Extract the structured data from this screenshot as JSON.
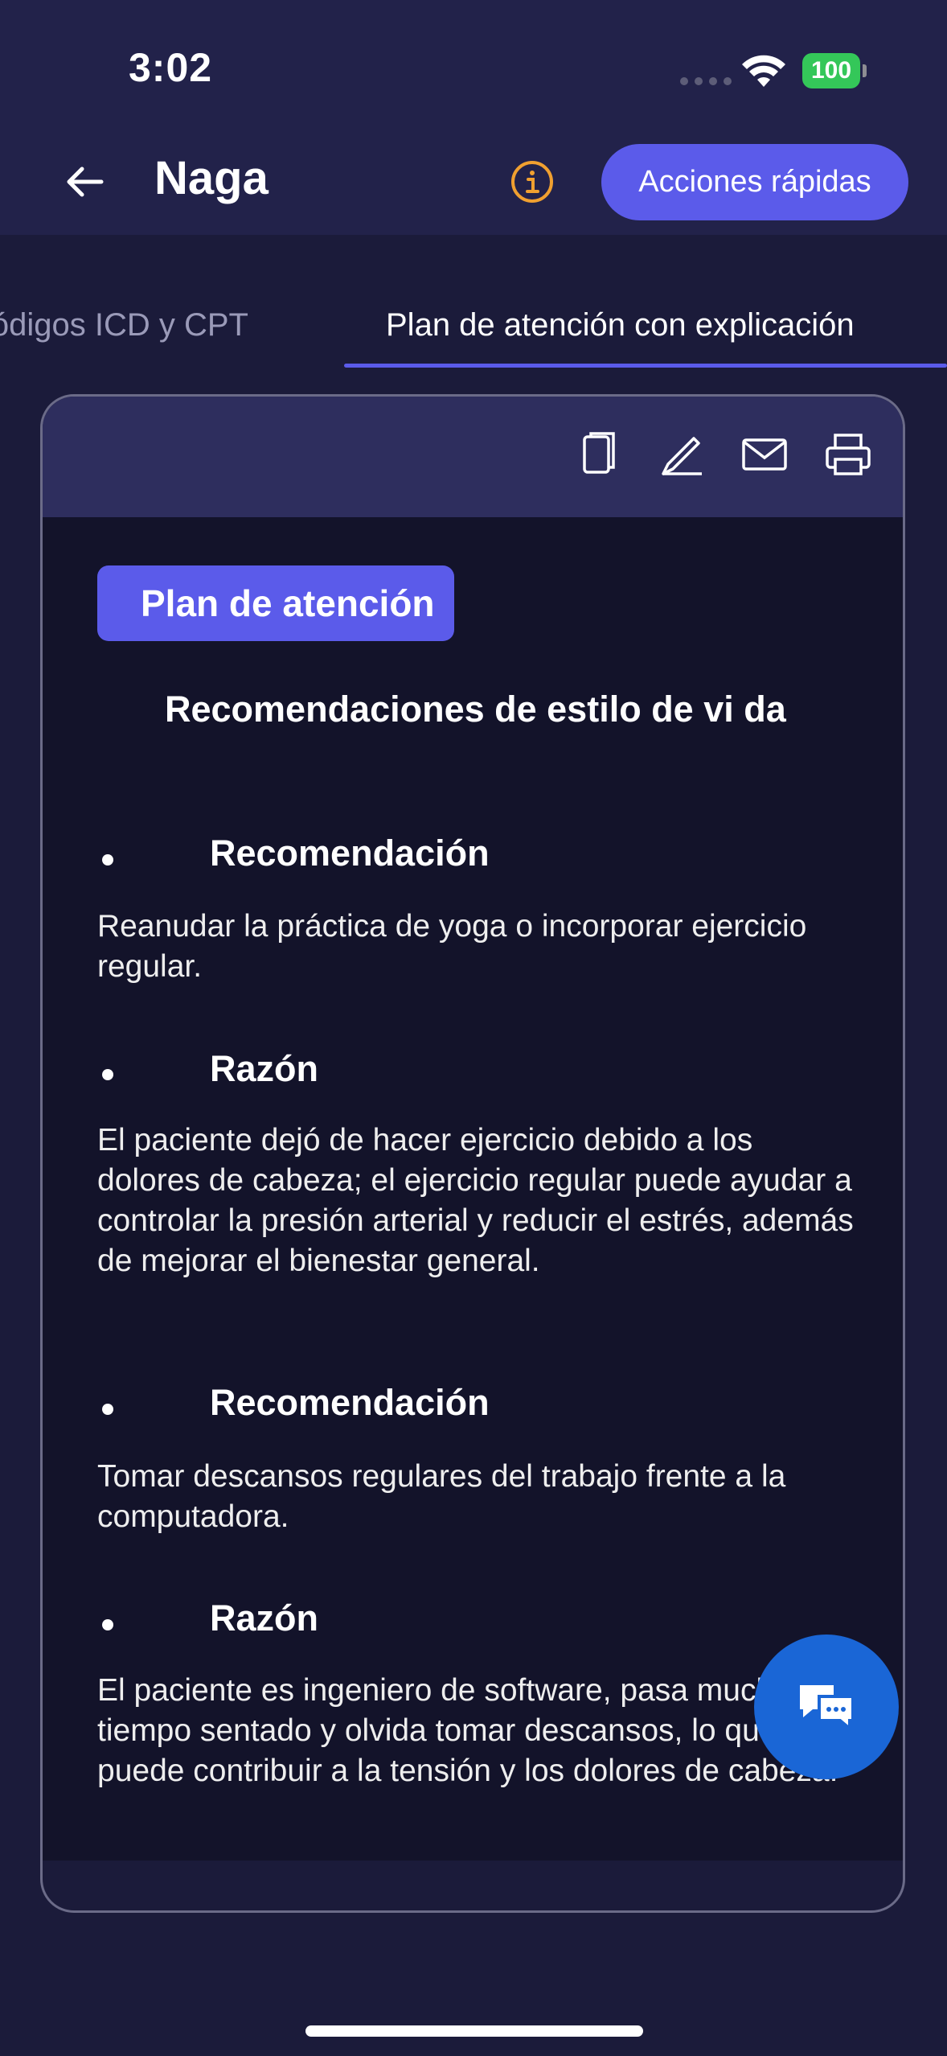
{
  "status_bar": {
    "time": "3:02",
    "battery": "100"
  },
  "header": {
    "title": "Naga",
    "quick_actions_label": "Acciones rápidas"
  },
  "tabs": [
    {
      "label": "Códigos ICD y CPT",
      "active": false
    },
    {
      "label": "Plan de atención con explicación",
      "active": true
    }
  ],
  "toolbar": {
    "icons": [
      "copy-icon",
      "edit-icon",
      "mail-icon",
      "print-icon"
    ]
  },
  "plan": {
    "badge": "Plan de atención",
    "subheading": "Recomendaciones de estilo de vi da",
    "items": [
      {
        "heading": "Recomendación",
        "text": "Reanudar la práctica de yoga o incorporar ejercicio regular."
      },
      {
        "heading": "Razón",
        "text": "El paciente dejó de hacer ejercicio debido a los dolores de cabeza; el ejercicio regular puede ayudar a controlar la presión arterial y reducir el estrés, además de mejorar el bienestar general."
      },
      {
        "heading": "Recomendación",
        "text": "Tomar descansos regulares del trabajo frente a la computadora."
      },
      {
        "heading": "Razón",
        "text": "El paciente es ingeniero de software, pasa mucho tiempo sentado y olvida tomar descansos, lo que puede contribuir a la tensión y los dolores de cabeza."
      }
    ]
  },
  "colors": {
    "accent": "#5b5bea",
    "background": "#1b1b3a",
    "content_bg": "#13132a",
    "info": "#f0a030",
    "fab": "#1a66d6"
  }
}
